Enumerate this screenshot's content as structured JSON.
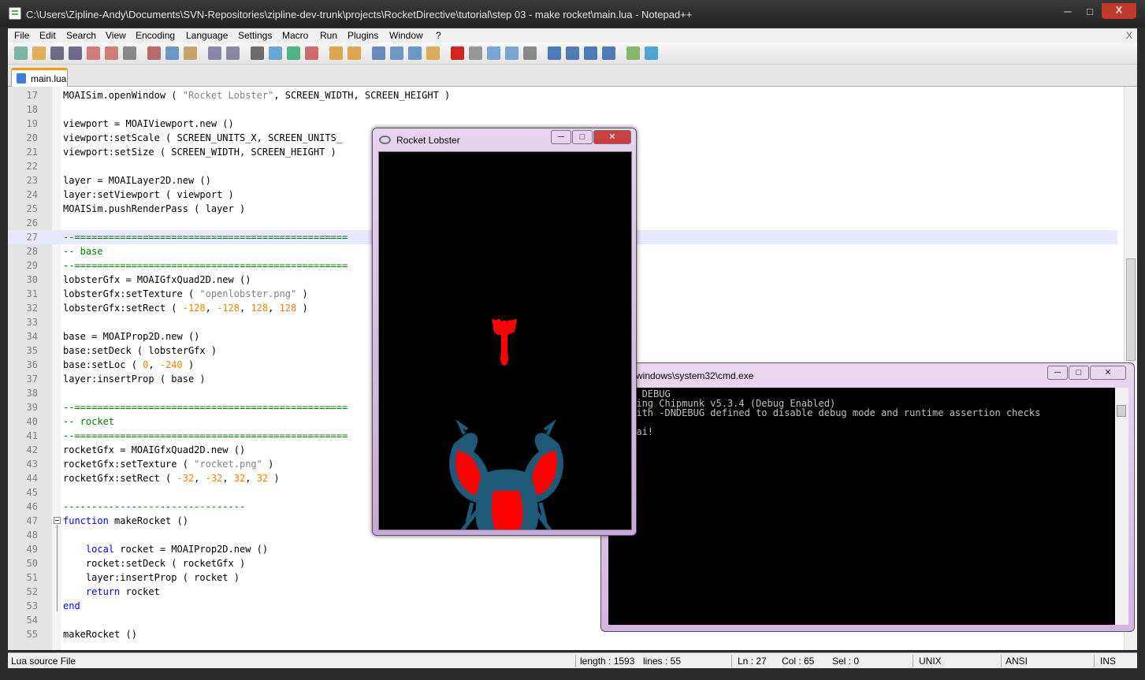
{
  "window": {
    "title": "C:\\Users\\Zipline-Andy\\Documents\\SVN-Repositories\\zipline-dev-trunk\\projects\\RocketDirective\\tutorial\\step 03 - make rocket\\main.lua - Notepad++",
    "minimize": "─",
    "maximize": "□",
    "close": "X",
    "doc_close": "X"
  },
  "menu": [
    "File",
    "Edit",
    "Search",
    "View",
    "Encoding",
    "Language",
    "Settings",
    "Macro",
    "Run",
    "Plugins",
    "Window",
    "?"
  ],
  "toolbar_icons": [
    "new-file-icon",
    "open-file-icon",
    "save-icon",
    "save-all-icon",
    "close-icon",
    "close-all-icon",
    "print-icon",
    "cut-icon",
    "copy-icon",
    "paste-icon",
    "undo-icon",
    "redo-icon",
    "find-icon",
    "replace-icon",
    "zoom-in-icon",
    "zoom-out-icon",
    "sync-vertical-icon",
    "sync-horizontal-icon",
    "word-wrap-icon",
    "show-all-chars-icon",
    "indent-guide-icon",
    "document-map-icon",
    "record-macro-icon",
    "stop-record-icon",
    "play-macro-icon",
    "play-multiple-icon",
    "save-macro-icon",
    "fold-all-icon",
    "up-icon",
    "down-icon",
    "unfold-all-icon",
    "run-icon",
    "spell-check-icon"
  ],
  "tab": {
    "label": "main.lua"
  },
  "code_lines": [
    {
      "n": "17",
      "code": [
        [
          "p",
          "MOAISim.openWindow ( "
        ],
        [
          "s",
          "\"Rocket Lobster\""
        ],
        [
          "p",
          ", SCREEN_WIDTH, SCREEN_HEIGHT )"
        ]
      ]
    },
    {
      "n": "18",
      "code": []
    },
    {
      "n": "19",
      "code": [
        [
          "p",
          "viewport = MOAIViewport.new ()"
        ]
      ]
    },
    {
      "n": "20",
      "code": [
        [
          "p",
          "viewport:setScale ( SCREEN_UNITS_X, SCREEN_UNITS_"
        ]
      ]
    },
    {
      "n": "21",
      "code": [
        [
          "p",
          "viewport:setSize ( SCREEN_WIDTH, SCREEN_HEIGHT )"
        ]
      ]
    },
    {
      "n": "22",
      "code": []
    },
    {
      "n": "23",
      "code": [
        [
          "p",
          "layer = MOAILayer2D.new ()"
        ]
      ]
    },
    {
      "n": "24",
      "code": [
        [
          "p",
          "layer:setViewport ( viewport )"
        ]
      ]
    },
    {
      "n": "25",
      "code": [
        [
          "p",
          "MOAISim.pushRenderPass ( layer )"
        ]
      ]
    },
    {
      "n": "26",
      "code": []
    },
    {
      "n": "27",
      "code": [
        [
          "c",
          "--================================================"
        ]
      ]
    },
    {
      "n": "28",
      "code": [
        [
          "c",
          "-- base"
        ]
      ]
    },
    {
      "n": "29",
      "code": [
        [
          "c",
          "--================================================"
        ]
      ]
    },
    {
      "n": "30",
      "code": [
        [
          "p",
          "lobsterGfx = MOAIGfxQuad2D.new ()"
        ]
      ]
    },
    {
      "n": "31",
      "code": [
        [
          "p",
          "lobsterGfx:setTexture ( "
        ],
        [
          "s",
          "\"openlobster.png\""
        ],
        [
          "p",
          " )"
        ]
      ]
    },
    {
      "n": "32",
      "code": [
        [
          "p",
          "lobsterGfx:setRect ( "
        ],
        [
          "n",
          "-128"
        ],
        [
          "p",
          ", "
        ],
        [
          "n",
          "-128"
        ],
        [
          "p",
          ", "
        ],
        [
          "n",
          "128"
        ],
        [
          "p",
          ", "
        ],
        [
          "n",
          "128"
        ],
        [
          "p",
          " )"
        ]
      ]
    },
    {
      "n": "33",
      "code": []
    },
    {
      "n": "34",
      "code": [
        [
          "p",
          "base = MOAIProp2D.new ()"
        ]
      ]
    },
    {
      "n": "35",
      "code": [
        [
          "p",
          "base:setDeck ( lobsterGfx )"
        ]
      ]
    },
    {
      "n": "36",
      "code": [
        [
          "p",
          "base:setLoc ( "
        ],
        [
          "n",
          "0"
        ],
        [
          "p",
          ", "
        ],
        [
          "n",
          "-240"
        ],
        [
          "p",
          " )"
        ]
      ]
    },
    {
      "n": "37",
      "code": [
        [
          "p",
          "layer:insertProp ( base )"
        ]
      ]
    },
    {
      "n": "38",
      "code": []
    },
    {
      "n": "39",
      "code": [
        [
          "c",
          "--================================================"
        ]
      ]
    },
    {
      "n": "40",
      "code": [
        [
          "c",
          "-- rocket"
        ]
      ]
    },
    {
      "n": "41",
      "code": [
        [
          "c",
          "--================================================"
        ]
      ]
    },
    {
      "n": "42",
      "code": [
        [
          "p",
          "rocketGfx = MOAIGfxQuad2D.new ()"
        ]
      ]
    },
    {
      "n": "43",
      "code": [
        [
          "p",
          "rocketGfx:setTexture ( "
        ],
        [
          "s",
          "\"rocket.png\""
        ],
        [
          "p",
          " )"
        ]
      ]
    },
    {
      "n": "44",
      "code": [
        [
          "p",
          "rocketGfx:setRect ( "
        ],
        [
          "n",
          "-32"
        ],
        [
          "p",
          ", "
        ],
        [
          "n",
          "-32"
        ],
        [
          "p",
          ", "
        ],
        [
          "n",
          "32"
        ],
        [
          "p",
          ", "
        ],
        [
          "n",
          "32"
        ],
        [
          "p",
          " )"
        ]
      ]
    },
    {
      "n": "45",
      "code": []
    },
    {
      "n": "46",
      "code": [
        [
          "c",
          "--------------------------------"
        ]
      ]
    },
    {
      "n": "47",
      "code": [
        [
          "k",
          "function"
        ],
        [
          "p",
          " makeRocket ()"
        ]
      ]
    },
    {
      "n": "48",
      "code": []
    },
    {
      "n": "49",
      "code": [
        [
          "p",
          "    "
        ],
        [
          "k",
          "local"
        ],
        [
          "p",
          " rocket = MOAIProp2D.new ()"
        ]
      ]
    },
    {
      "n": "50",
      "code": [
        [
          "p",
          "    rocket:setDeck ( rocketGfx )"
        ]
      ]
    },
    {
      "n": "51",
      "code": [
        [
          "p",
          "    layer:insertProp ( rocket )"
        ]
      ]
    },
    {
      "n": "52",
      "code": [
        [
          "p",
          "    "
        ],
        [
          "k",
          "return"
        ],
        [
          "p",
          " rocket"
        ]
      ]
    },
    {
      "n": "53",
      "code": [
        [
          "k",
          "end"
        ]
      ]
    },
    {
      "n": "54",
      "code": []
    },
    {
      "n": "55",
      "code": [
        [
          "p",
          "makeRocket ()"
        ]
      ]
    }
  ],
  "current_line": "27",
  "status": {
    "file_type": "Lua source File",
    "length": "length : 1593",
    "lines": "lines : 55",
    "ln": "Ln : 27",
    "col": "Col : 65",
    "sel": "Sel : 0",
    "eol": "UNIX",
    "encoding": "ANSI",
    "mode": "INS"
  },
  "rocket_window": {
    "title": "Rocket Lobster",
    "minimize": "─",
    "maximize": "□",
    "close": "✕"
  },
  "cmd_window": {
    "title": "windows\\system32\\cmd.exe",
    "minimize": "─",
    "maximize": "□",
    "close": "✕",
    "lines": [
      " -OPEN DEBUG",
      " nalizing Chipmunk v5.3.4 (Debug Enabled)",
      " ile with -DNDEBUG defined to disable debug mode and runtime assertion checks",
      "",
      " o, moai!"
    ]
  },
  "colors": {
    "keyword": "#0000ff",
    "string": "#808080",
    "number": "#ff8000",
    "comment": "#008000",
    "rocket": "#ff0000",
    "lobster_blue": "#1e5a78"
  }
}
